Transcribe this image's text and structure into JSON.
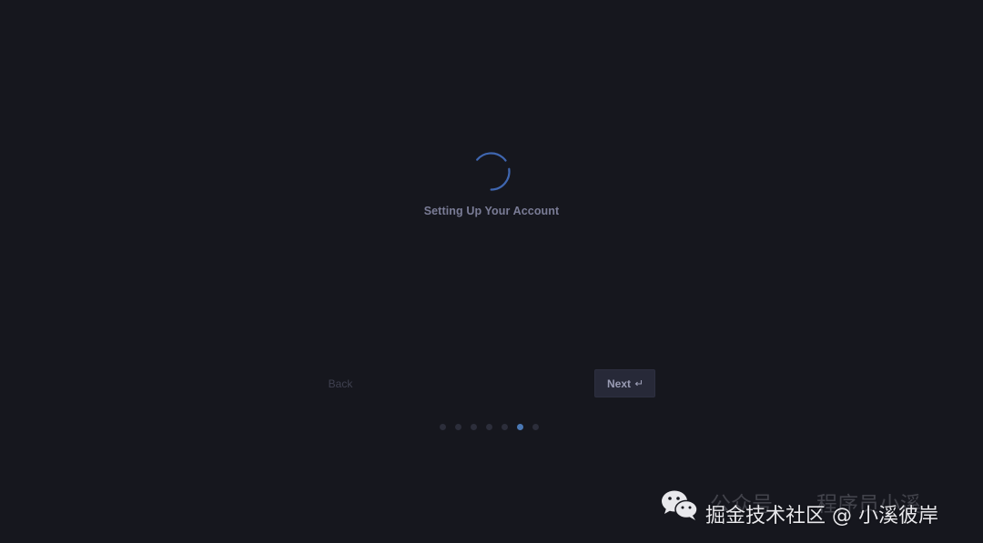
{
  "setup": {
    "status_text": "Setting Up Your Account",
    "spinner_icon": "loading-spinner-icon"
  },
  "navigation": {
    "back_label": "Back",
    "next_label": "Next",
    "next_icon": "enter-key-icon"
  },
  "steps": {
    "total": 7,
    "current": 6
  },
  "watermark": {
    "line1_left": "公众号",
    "line1_right": "程序员小溪",
    "line2": "掘金技术社区 @ 小溪彼岸",
    "icon": "wechat-icon"
  },
  "colors": {
    "background": "#16171e",
    "accent": "#4a78b4",
    "spinner": "#3f66b0"
  }
}
